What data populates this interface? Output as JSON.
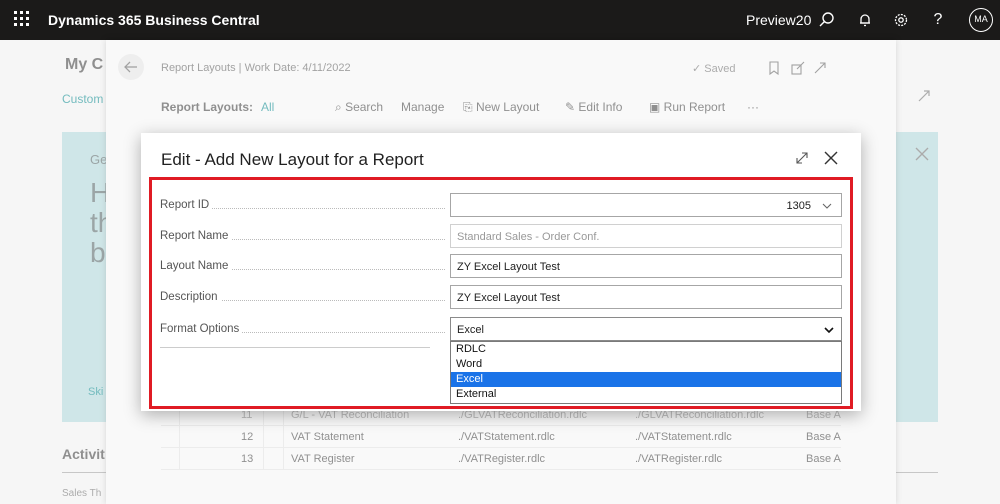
{
  "appbar": {
    "brand": "Dynamics 365 Business Central",
    "environment": "Preview20",
    "avatar": "MA",
    "icons": [
      "waffle-icon",
      "search-icon",
      "bell-icon",
      "gear-icon",
      "help-icon"
    ]
  },
  "background": {
    "title": "My C",
    "customize": "Custom",
    "teal_heading": "Ge",
    "teal_big_lines": [
      "H",
      "th",
      "b"
    ],
    "skip": "Ski",
    "activities": "Activit",
    "sales": "Sales Th"
  },
  "report_layouts": {
    "breadcrumb": "Report Layouts | Work Date: 4/11/2022",
    "saved": "Saved",
    "actions": {
      "title": "Report Layouts:",
      "filter": "All",
      "search": "Search",
      "manage": "Manage",
      "new_layout": "New Layout",
      "edit_info": "Edit Info",
      "run_report": "Run Report",
      "more": "···"
    },
    "rows": [
      {
        "id": "11",
        "name": "G/L - VAT Reconciliation",
        "layout": "./GLVATReconciliation.rdlc",
        "file": "./GLVATReconciliation.rdlc",
        "app": "Base A"
      },
      {
        "id": "12",
        "name": "VAT Statement",
        "layout": "./VATStatement.rdlc",
        "file": "./VATStatement.rdlc",
        "app": "Base A"
      },
      {
        "id": "13",
        "name": "VAT Register",
        "layout": "./VATRegister.rdlc",
        "file": "./VATRegister.rdlc",
        "app": "Base A"
      }
    ]
  },
  "dialog": {
    "title": "Edit - Add New Layout for a Report",
    "fields": {
      "report_id": {
        "label": "Report ID",
        "value": "1305"
      },
      "report_name": {
        "label": "Report Name",
        "placeholder": "Standard Sales - Order Conf."
      },
      "layout_name": {
        "label": "Layout Name",
        "value": "ZY Excel Layout Test"
      },
      "description": {
        "label": "Description",
        "value": "ZY Excel Layout Test"
      },
      "format_options": {
        "label": "Format Options",
        "value": "Excel"
      }
    },
    "dropdown_options": [
      "RDLC",
      "Word",
      "Excel",
      "External"
    ],
    "selected_option": "Excel",
    "highlight_color": "#e01b24",
    "selection_color": "#1a73e8"
  }
}
